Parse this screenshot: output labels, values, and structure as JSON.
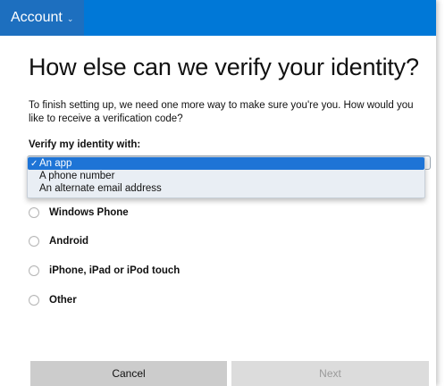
{
  "header": {
    "account_label": "Account",
    "chevron_icon": "chevron-down-icon",
    "bg_color": "#0078d7"
  },
  "page": {
    "title": "How else can we verify your identity?",
    "description": "To finish setting up, we need one more way to make sure you're you. How would you like to receive a verification code?",
    "verify_label": "Verify my identity with:"
  },
  "verify_select": {
    "options": [
      {
        "label": "An app",
        "selected": true
      },
      {
        "label": "A phone number",
        "selected": false
      },
      {
        "label": "An alternate email address",
        "selected": false
      }
    ],
    "check_icon": "checkmark-icon"
  },
  "device_options": [
    {
      "label": "Windows Phone"
    },
    {
      "label": "Android"
    },
    {
      "label": "iPhone, iPad or iPod touch"
    },
    {
      "label": "Other"
    }
  ],
  "buttons": {
    "cancel": "Cancel",
    "next": "Next"
  }
}
